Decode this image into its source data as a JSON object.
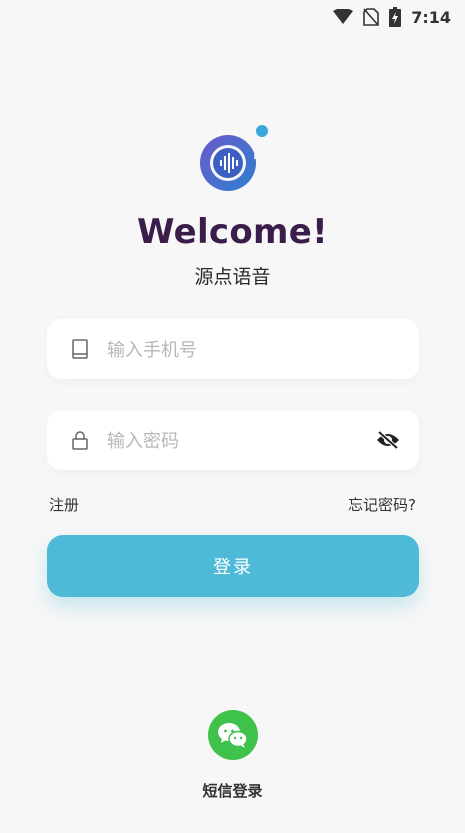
{
  "status_bar": {
    "time": "7:14",
    "icons": [
      "wifi-icon",
      "no-sim-icon",
      "battery-charging-icon"
    ]
  },
  "logo": {
    "icon": "audio-wave-logo-icon"
  },
  "header": {
    "welcome": "Welcome!",
    "app_name": "源点语音"
  },
  "form": {
    "phone": {
      "placeholder": "输入手机号",
      "icon": "phone-icon"
    },
    "password": {
      "placeholder": "输入密码",
      "icon": "lock-icon",
      "toggle_icon": "eye-off-icon"
    },
    "register_label": "注册",
    "forgot_label": "忘记密码?",
    "login_label": "登录"
  },
  "alt_login": {
    "icon": "wechat-icon",
    "label": "短信登录"
  },
  "colors": {
    "accent": "#4fbad8",
    "title": "#3a1d4a",
    "wechat": "#3ec24b",
    "logo_ring": "#4a5dc0"
  }
}
